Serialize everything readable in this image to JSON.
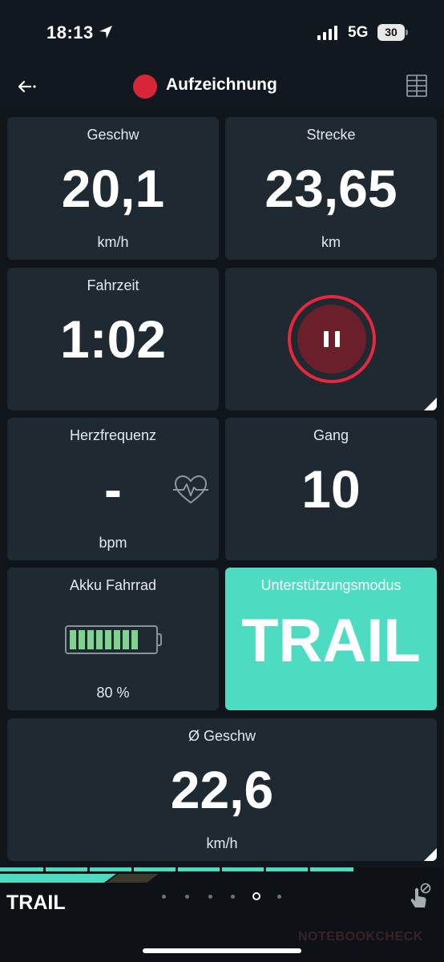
{
  "status_bar": {
    "time": "18:13",
    "network": "5G",
    "battery_level": "30"
  },
  "header": {
    "title": "Aufzeichnung",
    "recording_color": "#d72638",
    "icons": [
      "back-arrow-icon",
      "record-icon",
      "layout-grid-icon"
    ]
  },
  "tiles": {
    "speed": {
      "label": "Geschw",
      "value": "20,1",
      "unit": "km/h"
    },
    "distance": {
      "label": "Strecke",
      "value": "23,65",
      "unit": "km"
    },
    "ride_time": {
      "label": "Fahrzeit",
      "value": "1:02"
    },
    "pause": {
      "icon": "pause-icon",
      "accent": "#e8263c"
    },
    "heart_rate": {
      "label": "Herzfrequenz",
      "value": "-",
      "unit": "bpm",
      "icon": "heart-rate-icon"
    },
    "gear": {
      "label": "Gang",
      "value": "10"
    },
    "bike_battery": {
      "label": "Akku Fahrrad",
      "value": "80 %",
      "level_fraction": 0.8,
      "segment_color": "#7fd38e"
    },
    "assist_mode": {
      "label": "Unterstützungsmodus",
      "value": "TRAIL",
      "color": "#4ddbc1"
    },
    "avg_speed": {
      "label": "Ø Geschw",
      "value": "22,6",
      "unit": "km/h"
    }
  },
  "bottom_bar": {
    "mode_label": "TRAIL",
    "page_count": 6,
    "active_page": 5,
    "icons": [
      "touch-icon"
    ]
  },
  "watermark": "NOTEBOOKCHECK"
}
